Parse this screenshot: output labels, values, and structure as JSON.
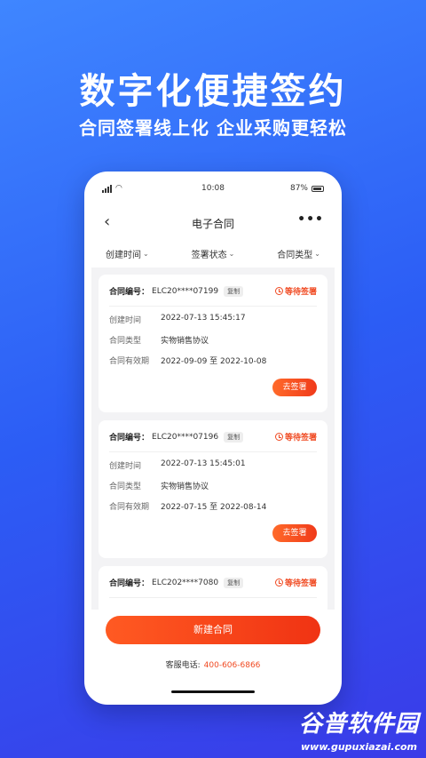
{
  "hero": {
    "title": "数字化便捷签约",
    "subtitle": "合同签署线上化 企业采购更轻松"
  },
  "status_bar": {
    "time": "10:08",
    "battery": "87%"
  },
  "nav": {
    "back_icon": "chevron-left-icon",
    "title": "电子合同",
    "more_label": "•••"
  },
  "filters": [
    {
      "label": "创建时间",
      "chevron": "⌄"
    },
    {
      "label": "签署状态",
      "chevron": "⌄"
    },
    {
      "label": "合同类型",
      "chevron": "⌄"
    }
  ],
  "labels": {
    "contract_no": "合同编号：",
    "copy": "复制",
    "created": "创建时间",
    "type": "合同类型",
    "validity": "合同有效期"
  },
  "contracts": [
    {
      "number": "ELC20****07199",
      "status": "等待签署",
      "created": "2022-07-13 15:45:17",
      "type": "实物销售协议",
      "validity": "2022-09-09 至 2022-10-08",
      "action": "去签署"
    },
    {
      "number": "ELC20****07196",
      "status": "等待签署",
      "created": "2022-07-13 15:45:01",
      "type": "实物销售协议",
      "validity": "2022-07-15 至 2022-08-14",
      "action": "去签署"
    },
    {
      "number": "ELC202****7080",
      "status": "等待签署"
    }
  ],
  "new_button": "新建合同",
  "service": {
    "label": "客服电话:",
    "phone": "400-606-6866"
  },
  "watermark": {
    "brand": "谷普软件园",
    "url": "www.gupuxiazai.com"
  },
  "colors": {
    "accent": "#f04a22",
    "background": "#2c5df5"
  }
}
